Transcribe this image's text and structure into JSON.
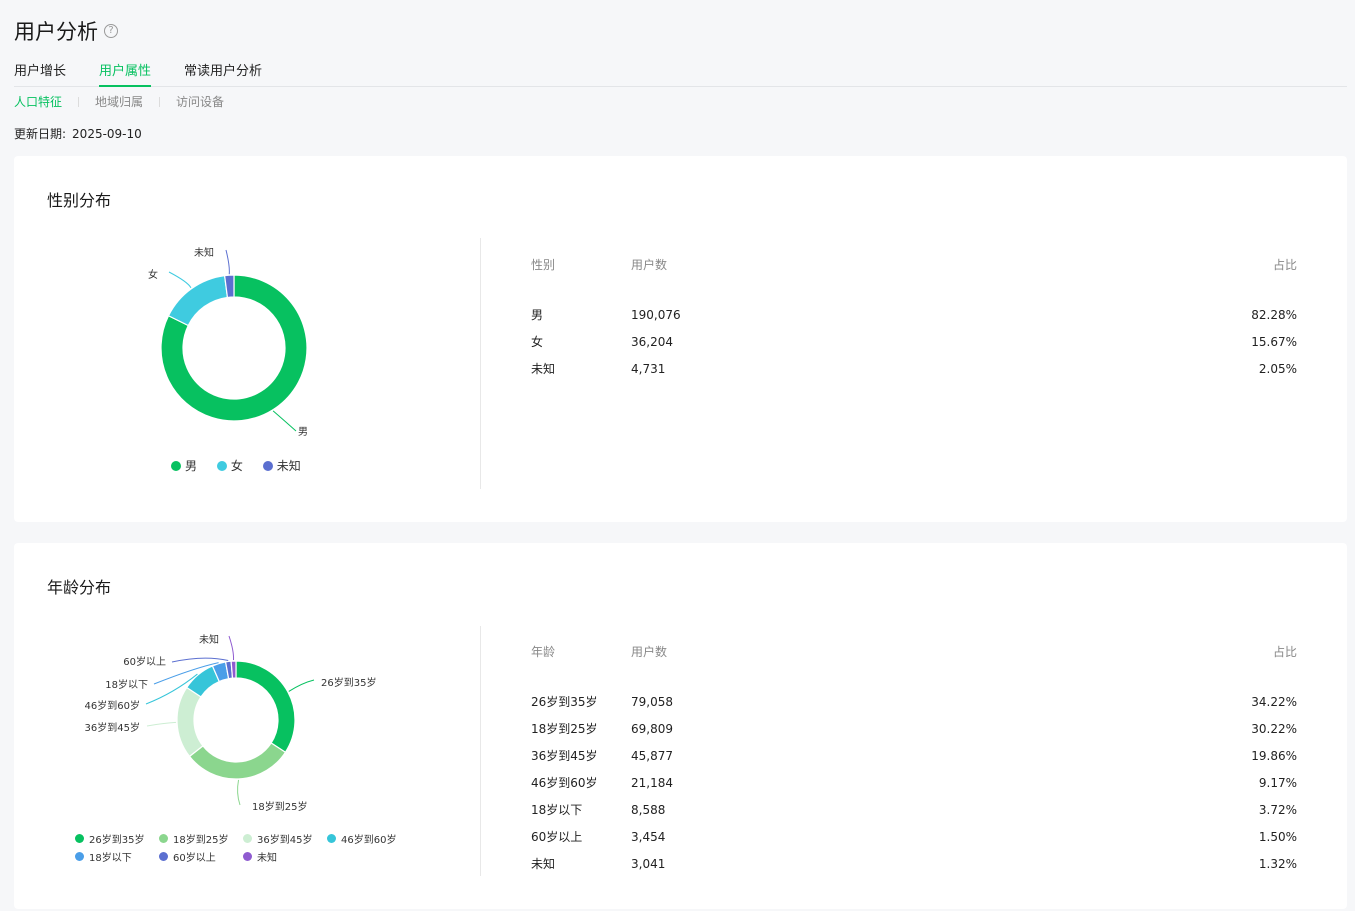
{
  "header": {
    "title": "用户分析",
    "help_icon": "question-circle-icon"
  },
  "tabs": [
    {
      "label": "用户增长",
      "active": false
    },
    {
      "label": "用户属性",
      "active": true
    },
    {
      "label": "常读用户分析",
      "active": false
    }
  ],
  "subtabs": [
    {
      "label": "人口特征",
      "active": true
    },
    {
      "label": "地域归属",
      "active": false
    },
    {
      "label": "访问设备",
      "active": false
    }
  ],
  "update": {
    "label": "更新日期:",
    "value": "2025-09-10"
  },
  "colors": {
    "accent": "#07c160"
  },
  "gender": {
    "title": "性别分布",
    "table": {
      "headers": [
        "性别",
        "用户数",
        "占比"
      ],
      "rows": [
        {
          "name": "男",
          "count": "190,076",
          "pct": "82.28%"
        },
        {
          "name": "女",
          "count": "36,204",
          "pct": "15.67%"
        },
        {
          "name": "未知",
          "count": "4,731",
          "pct": "2.05%"
        }
      ]
    }
  },
  "age": {
    "title": "年龄分布",
    "table": {
      "headers": [
        "年龄",
        "用户数",
        "占比"
      ],
      "rows": [
        {
          "name": "26岁到35岁",
          "count": "79,058",
          "pct": "34.22%"
        },
        {
          "name": "18岁到25岁",
          "count": "69,809",
          "pct": "30.22%"
        },
        {
          "name": "36岁到45岁",
          "count": "45,877",
          "pct": "19.86%"
        },
        {
          "name": "46岁到60岁",
          "count": "21,184",
          "pct": "9.17%"
        },
        {
          "name": "18岁以下",
          "count": "8,588",
          "pct": "3.72%"
        },
        {
          "name": "60岁以上",
          "count": "3,454",
          "pct": "1.50%"
        },
        {
          "name": "未知",
          "count": "3,041",
          "pct": "1.32%"
        }
      ]
    }
  },
  "chart_data": [
    {
      "type": "pie",
      "categories": [
        "男",
        "女",
        "未知"
      ],
      "values": [
        82.28,
        15.67,
        2.05
      ],
      "colors": [
        "#07c160",
        "#3fcbe0",
        "#5b6fd0"
      ],
      "legend": "bottom"
    },
    {
      "type": "pie",
      "categories": [
        "26岁到35岁",
        "18岁到25岁",
        "36岁到45岁",
        "46岁到60岁",
        "18岁以下",
        "60岁以上",
        "未知"
      ],
      "values": [
        34.22,
        30.22,
        19.86,
        9.17,
        3.72,
        1.5,
        1.32
      ],
      "colors": [
        "#07c160",
        "#8bd68e",
        "#cdeed3",
        "#36c5d9",
        "#4a9ee8",
        "#5b6fd0",
        "#8f5bd0"
      ],
      "legend": "bottom"
    }
  ]
}
